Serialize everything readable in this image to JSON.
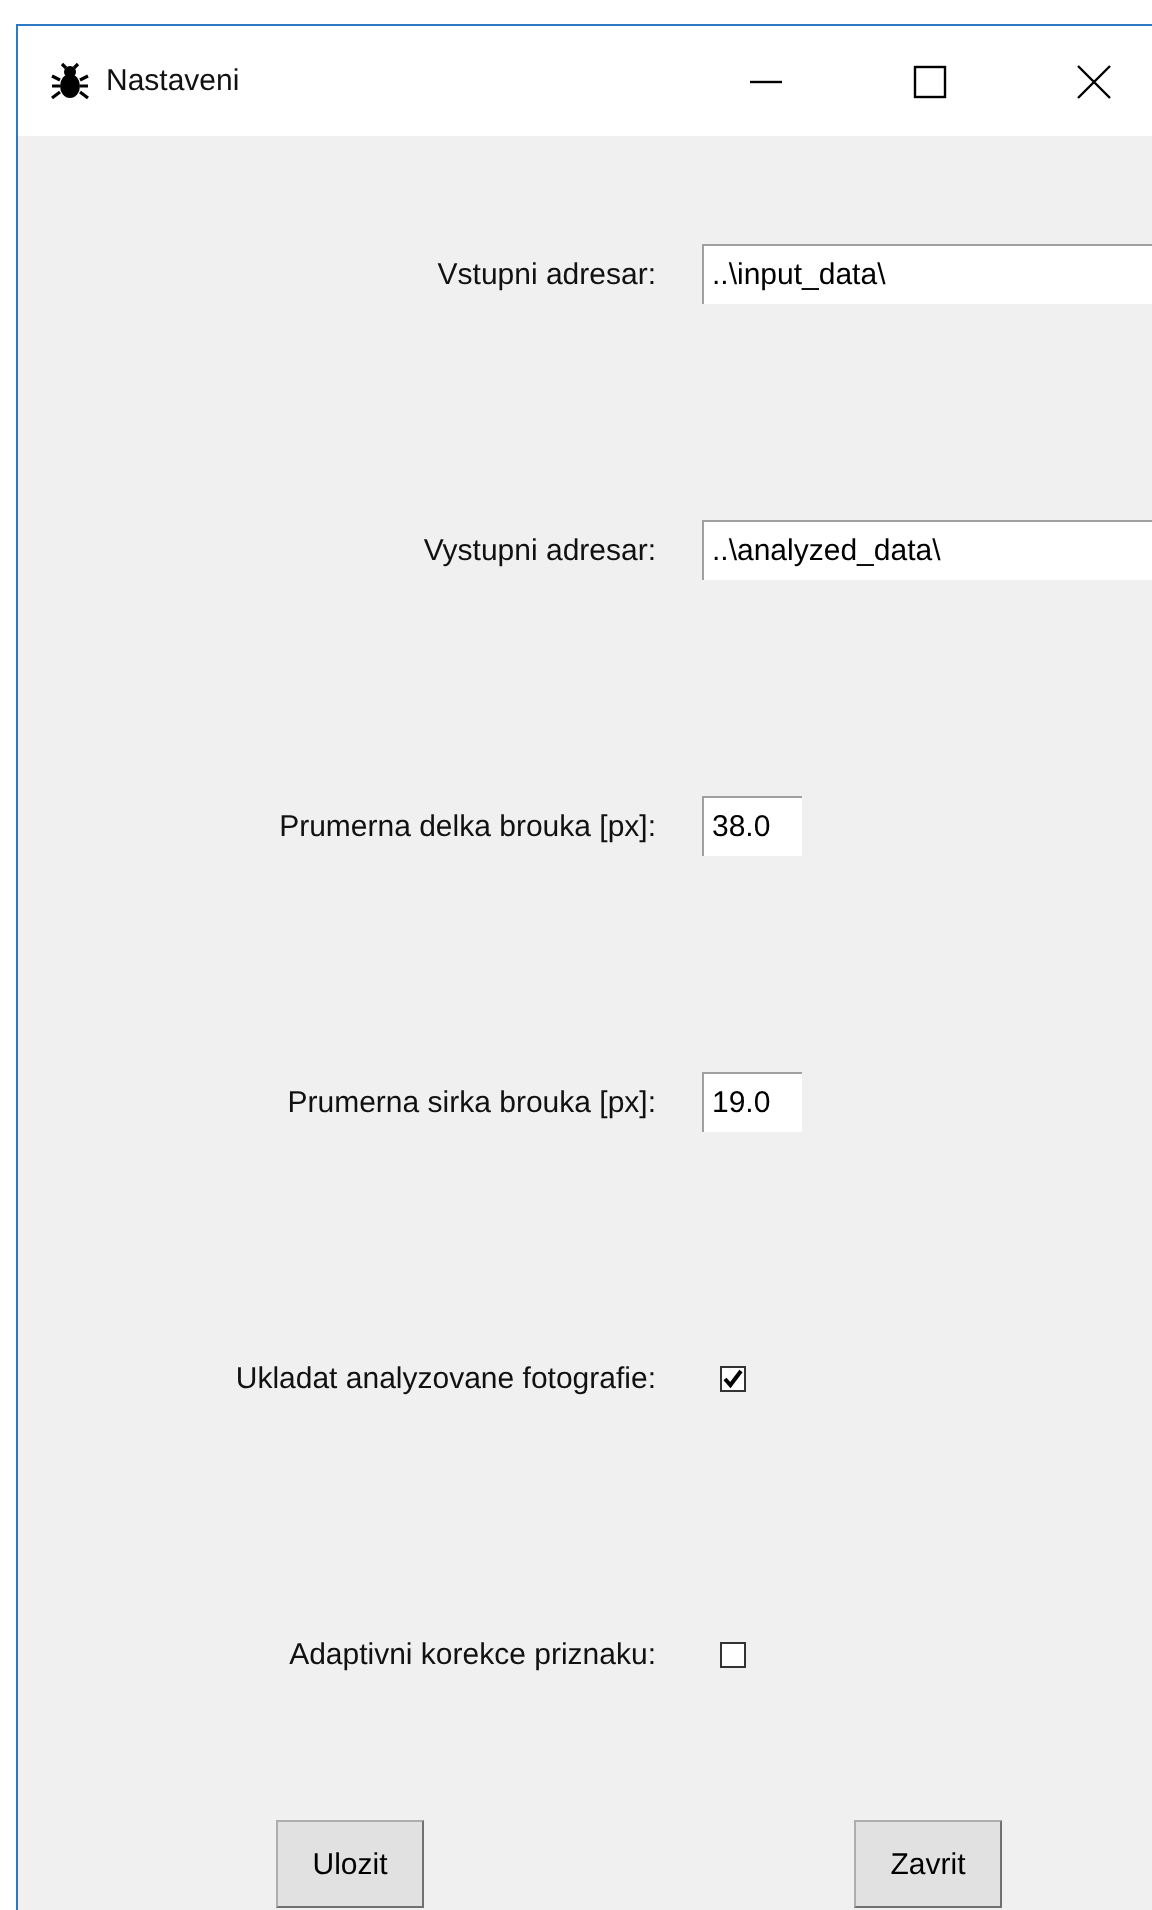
{
  "window": {
    "title": "Nastaveni"
  },
  "settings": [
    {
      "kind": "text",
      "label": "Vstupni adresar:",
      "value": "..\\input_data\\"
    },
    {
      "kind": "text",
      "label": "Vystupni adresar:",
      "value": "..\\analyzed_data\\"
    },
    {
      "kind": "number",
      "label": "Prumerna delka brouka [px]:",
      "value": "38.0"
    },
    {
      "kind": "number",
      "label": "Prumerna sirka brouka [px]:",
      "value": "19.0"
    },
    {
      "kind": "checkbox",
      "label": "Ukladat analyzovane fotografie:",
      "checked": true
    },
    {
      "kind": "checkbox",
      "label": "Adaptivni korekce priznaku:",
      "checked": false
    }
  ],
  "buttons": [
    "Ulozit",
    "Zavrit"
  ]
}
